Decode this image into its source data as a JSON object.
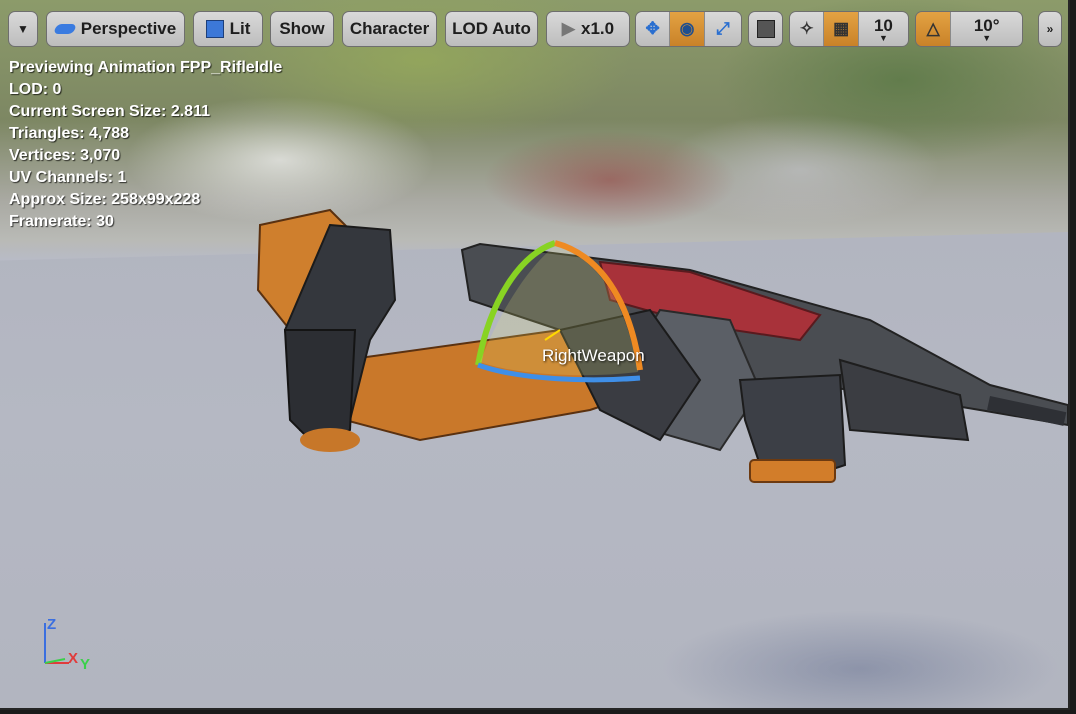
{
  "toolbar": {
    "menu_icon": "chevron-down-icon",
    "perspective_label": "Perspective",
    "lit_label": "Lit",
    "show_label": "Show",
    "character_label": "Character",
    "lod_label": "LOD Auto",
    "speed_label": "x1.0",
    "grid_snap_value": "10",
    "rotation_snap_value": "10°",
    "active_color": "#d08a2c"
  },
  "stats": {
    "line1": "Previewing Animation FPP_RifleIdle",
    "line2": "LOD: 0",
    "line3": "Current Screen Size: 2.811",
    "line4": "Triangles: 4,788",
    "line5": "Vertices: 3,070",
    "line6": "UV Channels: 1",
    "line7": "Approx Size: 258x99x228",
    "line8": "Framerate: 30"
  },
  "viewport": {
    "bone_label": "RightWeapon",
    "axis_z": "Z",
    "axis_x": "X",
    "axis_y": "Y"
  }
}
